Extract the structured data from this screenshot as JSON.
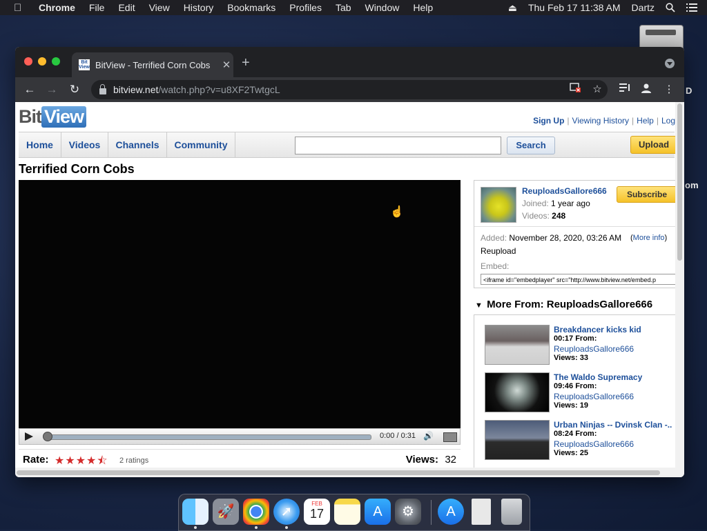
{
  "menubar": {
    "app_name": "Chrome",
    "items": [
      "File",
      "Edit",
      "View",
      "History",
      "Bookmarks",
      "Profiles",
      "Tab",
      "Window",
      "Help"
    ],
    "clock": "Thu Feb 17  11:38 AM",
    "user": "Dartz"
  },
  "desktop": {
    "label_d": "D",
    "label_om": "om"
  },
  "browser": {
    "tab_title": "BitView - Terrified Corn Cobs",
    "favicon_text": "Bit View",
    "url_host": "bitview.net",
    "url_path": "/watch.php?v=u8XF2TwtgcL"
  },
  "site": {
    "logo_bit": "Bit",
    "logo_view": "View",
    "top_links": [
      "Sign Up",
      "Viewing History",
      "Help",
      "Log"
    ],
    "nav": [
      "Home",
      "Videos",
      "Channels",
      "Community"
    ],
    "search_label": "Search",
    "upload_label": "Upload"
  },
  "video": {
    "title": "Terrified Corn Cobs",
    "time": "0:00 / 0:31",
    "progress_fraction": 0.0,
    "rate_label": "Rate:",
    "rating_stars": 4.5,
    "ratings_count": "2 ratings",
    "views_label": "Views:",
    "views_value": "32"
  },
  "uploader": {
    "name": "ReuploadsGallore666",
    "joined_label": "Joined:",
    "joined_value": "1 year ago",
    "videos_label": "Videos:",
    "videos_value": "248",
    "subscribe_label": "Subscribe",
    "added_label": "Added:",
    "added_value": "November 28, 2020, 03:26 AM",
    "more_info_label": "More info",
    "description": "Reupload",
    "embed_label": "Embed:",
    "embed_code": "<iframe id=\"embedplayer\" src=\"http://www.bitview.net/embed.p"
  },
  "more_from": {
    "heading": "More From: ReuploadsGallore666",
    "items": [
      {
        "title": "Breakdancer kicks kid",
        "meta": "00:17 From:",
        "user": "ReuploadsGallore666",
        "views": "Views: 33"
      },
      {
        "title": "The Waldo Supremacy",
        "meta": "09:46 From:",
        "user": "ReuploadsGallore666",
        "views": "Views: 19"
      },
      {
        "title": "Urban Ninjas -- Dvinsk Clan -..",
        "meta": "08:24 From:",
        "user": "ReuploadsGallore666",
        "views": "Views: 25"
      }
    ]
  },
  "dock": {
    "apps": [
      "finder-icon",
      "launchpad-icon",
      "chrome-icon",
      "safari-icon",
      "calendar-icon",
      "notes-icon",
      "app-store-icon",
      "system-preferences-icon",
      "downloads-icon",
      "document-icon",
      "trash-icon"
    ],
    "calendar_month": "FEB",
    "calendar_day": "17"
  }
}
